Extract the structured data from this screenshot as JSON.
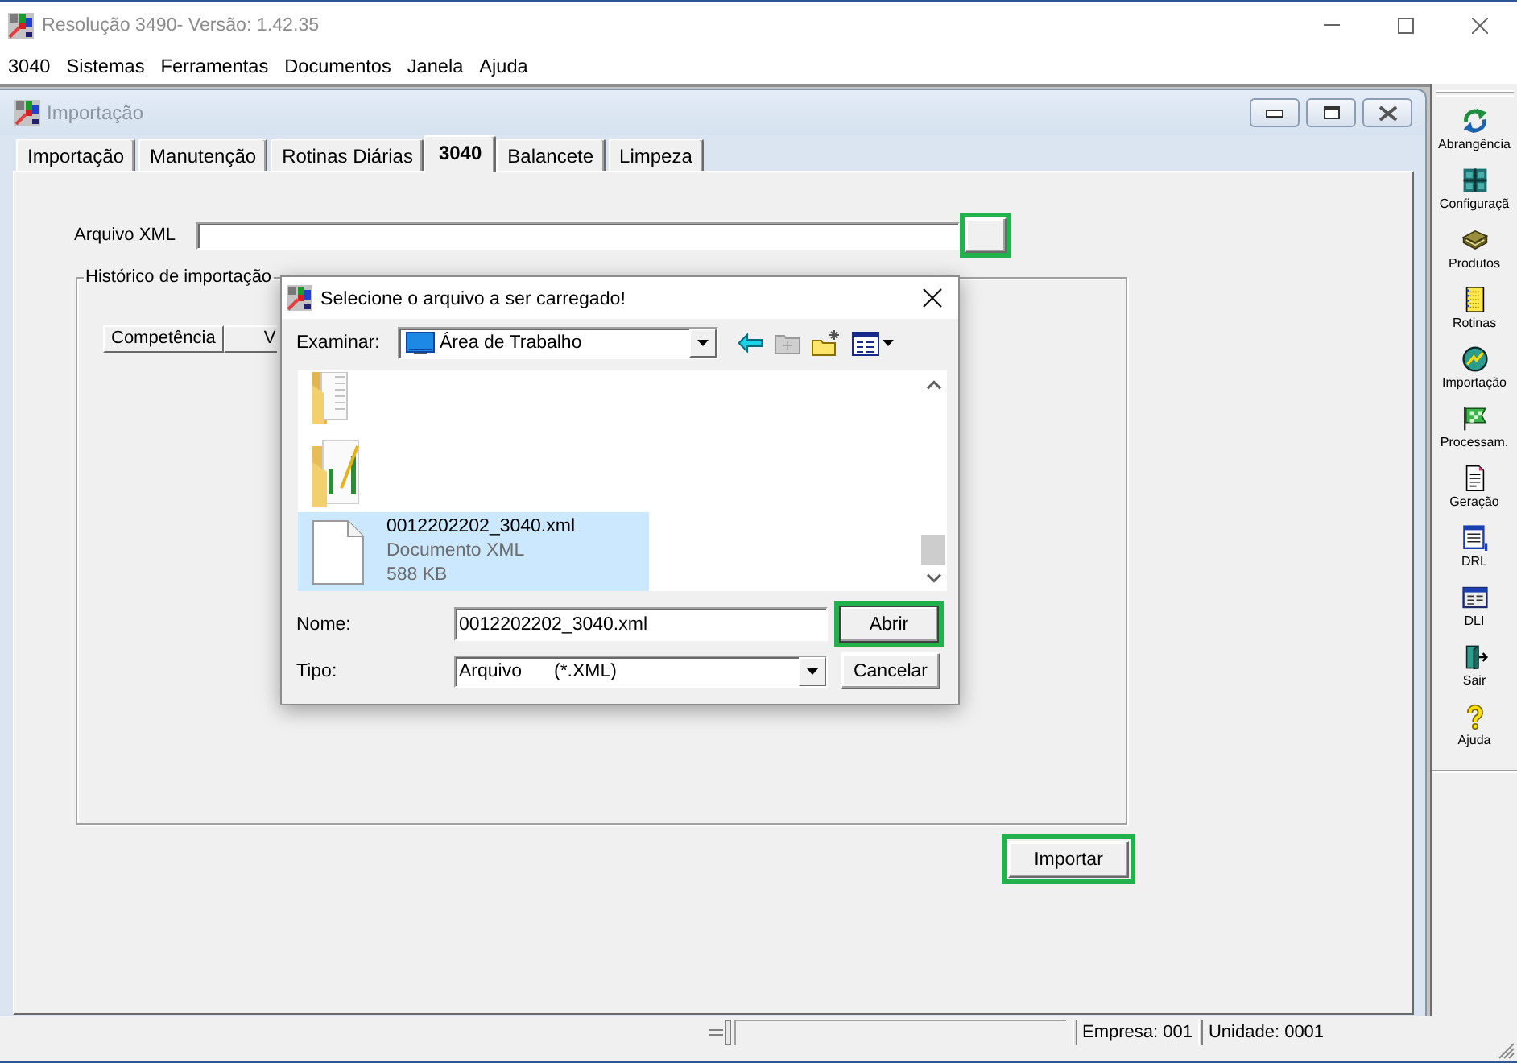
{
  "window": {
    "title": "Resolução 3490- Versão: 1.42.35"
  },
  "menu": [
    "3040",
    "Sistemas",
    "Ferramentas",
    "Documentos",
    "Janela",
    "Ajuda"
  ],
  "document_window": {
    "title": "Importação",
    "tabs": [
      {
        "label": "Importação",
        "selected": false
      },
      {
        "label": "Manutenção",
        "selected": false
      },
      {
        "label": "Rotinas Diárias",
        "selected": false
      },
      {
        "label": "3040",
        "selected": true
      },
      {
        "label": "Balancete",
        "selected": false
      },
      {
        "label": "Limpeza",
        "selected": false
      }
    ],
    "xml_file": {
      "label": "Arquivo XML",
      "browse_highlighted": true
    },
    "history": {
      "title": "Histórico de importação",
      "columns": [
        "Competência",
        "V"
      ]
    },
    "import_button": {
      "label": "Importar",
      "highlighted": true
    }
  },
  "file_dialog": {
    "title": "Selecione o arquivo a ser carregado!",
    "look_in": {
      "label": "Examinar:",
      "value": "Área de Trabalho"
    },
    "files": [
      {
        "kind": "folder",
        "selected": false
      },
      {
        "kind": "folder",
        "selected": false
      },
      {
        "kind": "file",
        "name": "0012202202_3040.xml",
        "type": "Documento XML",
        "size": "588 KB",
        "selected": true
      }
    ],
    "file_name": {
      "label": "Nome:",
      "value": "0012202202_3040.xml"
    },
    "file_type": {
      "label": "Tipo:",
      "value": "Arquivo",
      "pattern": "(*.XML)"
    },
    "buttons": [
      {
        "label": "Abrir",
        "highlighted": true
      },
      {
        "label": "Cancelar",
        "highlighted": false
      }
    ]
  },
  "toolbar": [
    "Abrangência",
    "Configuraçã",
    "Produtos",
    "Rotinas",
    "Importação",
    "Processam.",
    "Geração",
    "DRL",
    "DLI",
    "Sair",
    "Ajuda"
  ],
  "status_bar": [
    "Empresa: 001",
    "Unidade: 0001"
  ]
}
